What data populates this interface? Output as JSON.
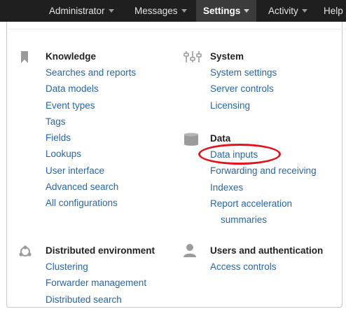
{
  "nav": {
    "items": [
      {
        "label": "Administrator"
      },
      {
        "label": "Messages"
      },
      {
        "label": "Settings"
      },
      {
        "label": "Activity"
      },
      {
        "label": "Help"
      }
    ]
  },
  "menu": {
    "knowledge": {
      "heading": "Knowledge",
      "icon": "bookmark-icon",
      "links": [
        "Searches and reports",
        "Data models",
        "Event types",
        "Tags",
        "Fields",
        "Lookups",
        "User interface",
        "Advanced search",
        "All configurations"
      ]
    },
    "system": {
      "heading": "System",
      "icon": "sliders-icon",
      "links": [
        "System settings",
        "Server controls",
        "Licensing"
      ]
    },
    "data": {
      "heading": "Data",
      "icon": "database-icon",
      "links": [
        "Data inputs",
        "Forwarding and receiving",
        "Indexes",
        "Report acceleration",
        "summaries"
      ]
    },
    "distributed": {
      "heading": "Distributed environment",
      "icon": "network-icon",
      "links": [
        "Clustering",
        "Forwarder management",
        "Distributed search"
      ]
    },
    "users": {
      "heading": "Users and authentication",
      "icon": "user-icon",
      "links": [
        "Access controls"
      ]
    }
  },
  "colors": {
    "topbar": "#1f1f1f",
    "link": "#2666a8",
    "highlight": "#e3141b"
  }
}
